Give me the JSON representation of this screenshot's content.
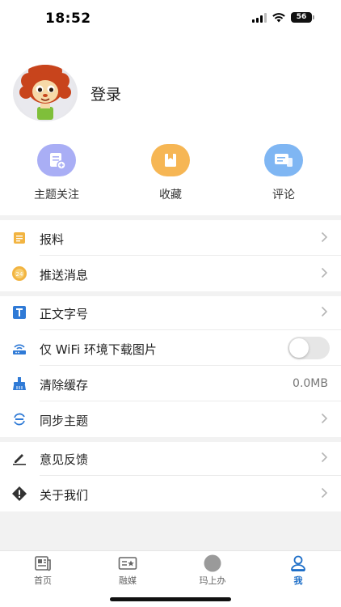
{
  "status_bar": {
    "time": "18:52",
    "battery": "56"
  },
  "profile": {
    "login_label": "登录",
    "avatar_icon": "lion-mascot-avatar"
  },
  "quick_actions": [
    {
      "label": "主题关注",
      "icon": "topic-follow-icon",
      "color": "#a9aef5"
    },
    {
      "label": "收藏",
      "icon": "favorites-icon",
      "color": "#f6b654"
    },
    {
      "label": "评论",
      "icon": "comment-icon",
      "color": "#7fb6f3"
    }
  ],
  "menu": {
    "baoliao": {
      "label": "报料",
      "icon": "report-note-icon"
    },
    "push": {
      "label": "推送消息",
      "icon": "push-message-icon"
    },
    "font_size": {
      "label": "正文字号",
      "icon": "text-size-icon"
    },
    "wifi_only": {
      "label": "仅 WiFi 环境下载图片",
      "icon": "wifi-download-icon",
      "enabled": false
    },
    "clear_cache": {
      "label": "清除缓存",
      "icon": "broom-icon",
      "value": "0.0MB"
    },
    "sync_theme": {
      "label": "同步主题",
      "icon": "sync-icon"
    },
    "feedback": {
      "label": "意见反馈",
      "icon": "pen-icon"
    },
    "about": {
      "label": "关于我们",
      "icon": "info-diamond-icon"
    }
  },
  "tabbar": {
    "tabs": [
      {
        "label": "首页",
        "icon": "newspaper-icon"
      },
      {
        "label": "融媒",
        "icon": "media-card-icon"
      },
      {
        "label": "玛上办",
        "icon": "service-circle-icon"
      },
      {
        "label": "我",
        "icon": "person-icon"
      }
    ],
    "active_color": "#1e6fc8"
  }
}
